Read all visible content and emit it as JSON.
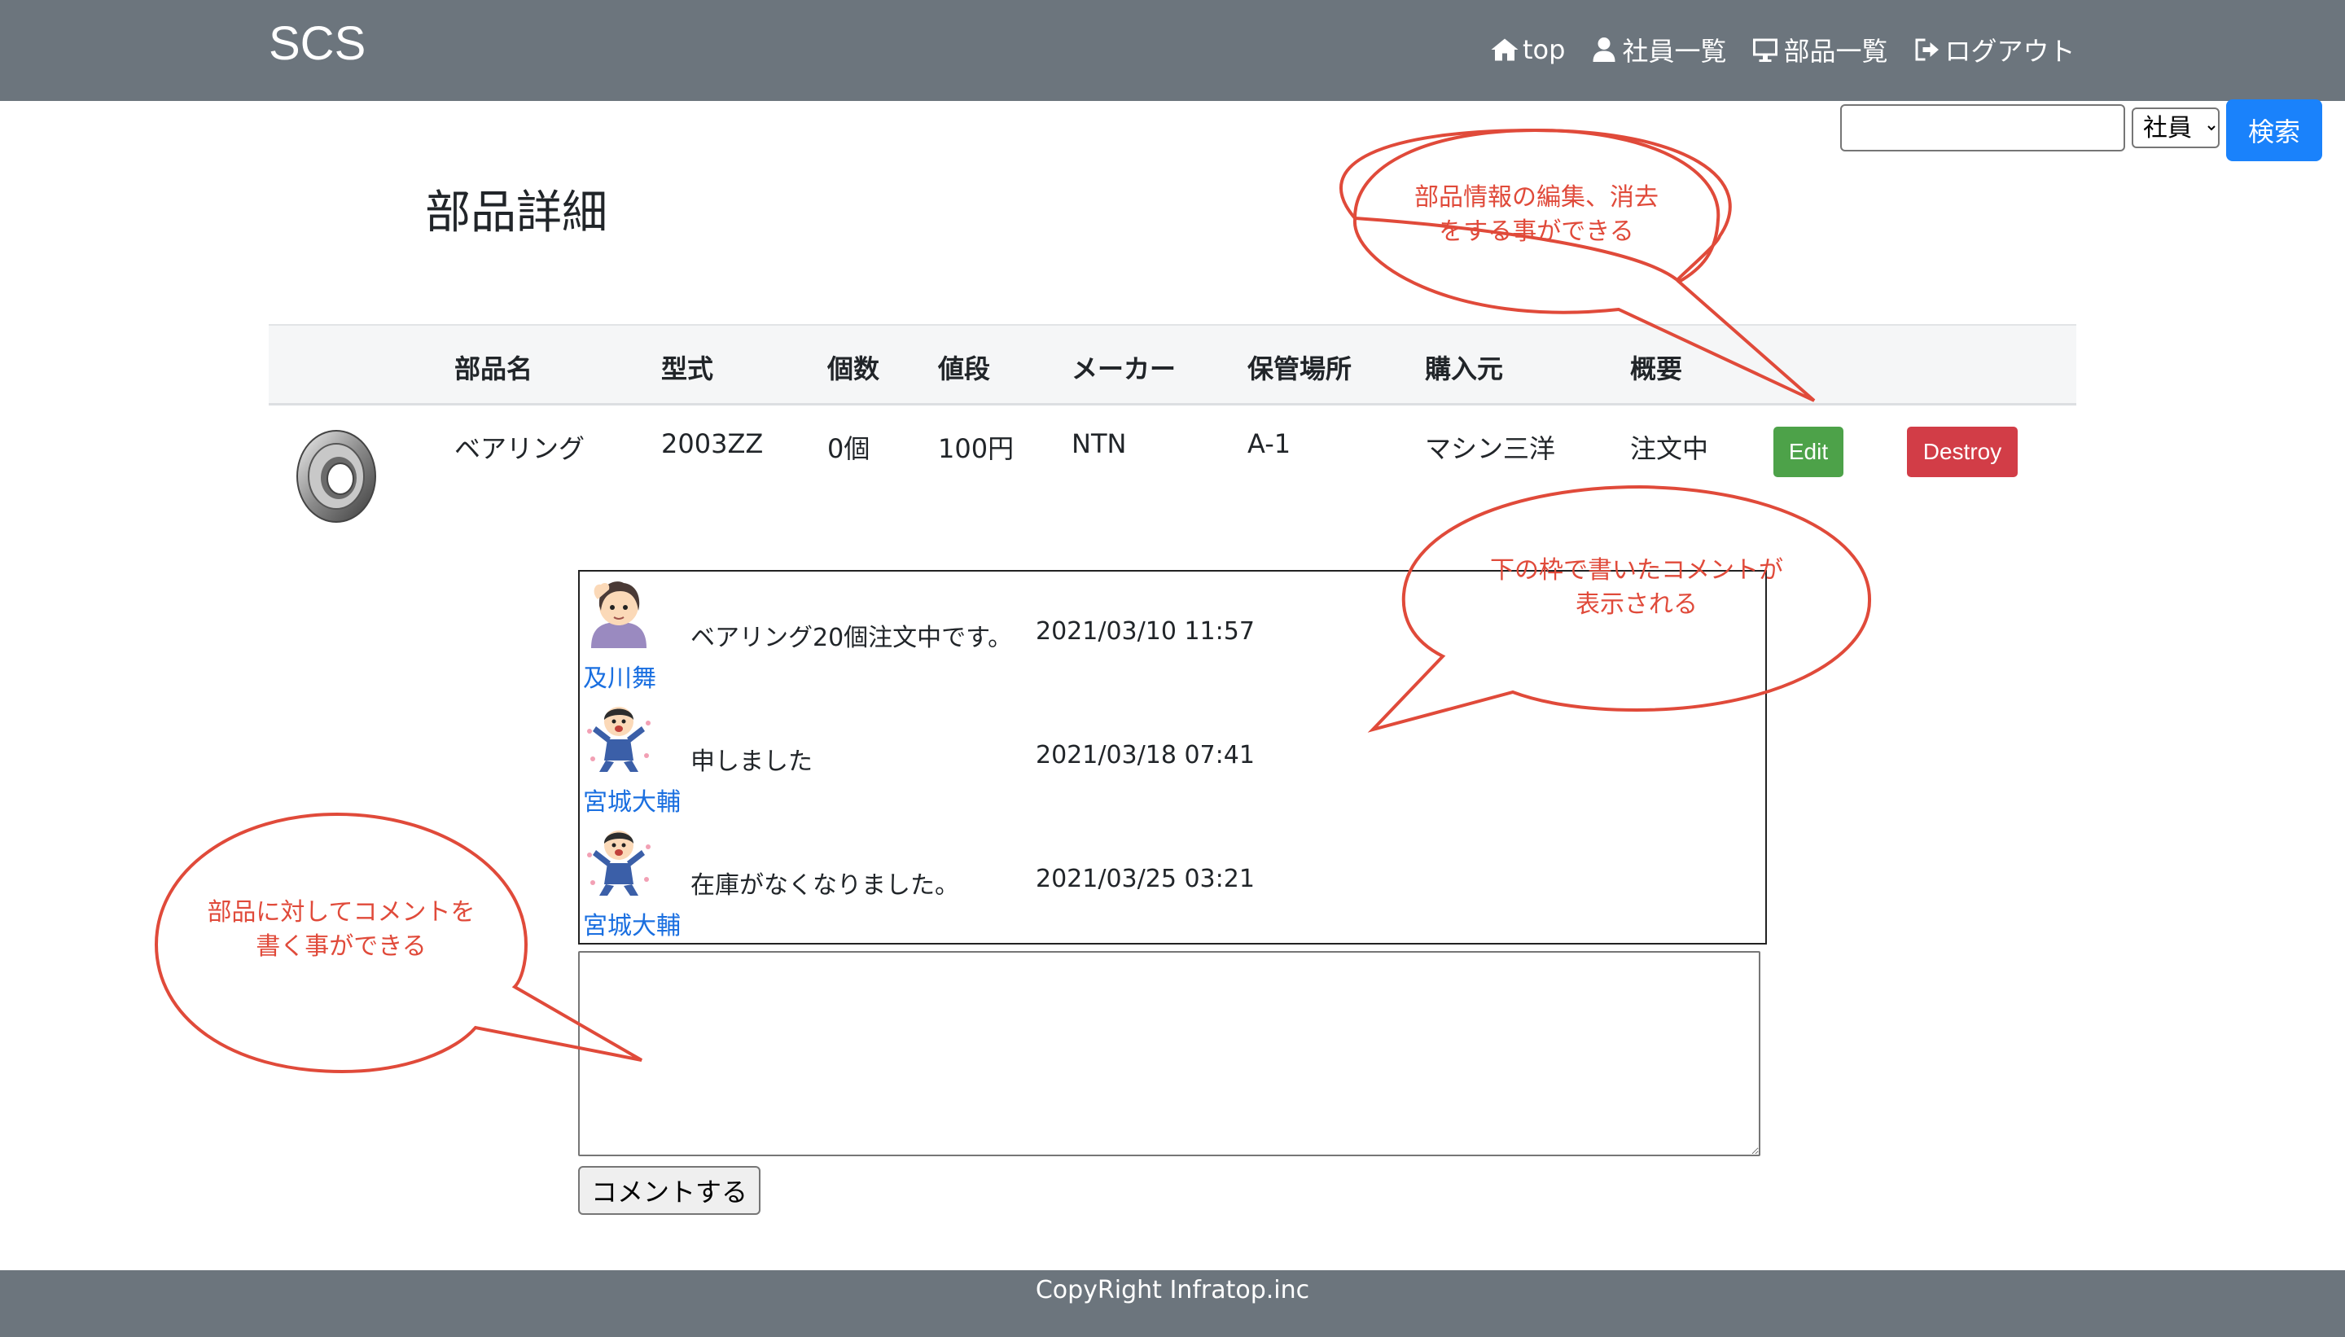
{
  "navbar": {
    "brand": "SCS",
    "links": [
      {
        "icon": "home-icon",
        "label": "top"
      },
      {
        "icon": "user-icon",
        "label": "社員一覧"
      },
      {
        "icon": "monitor-icon",
        "label": "部品一覧"
      },
      {
        "icon": "logout-icon",
        "label": "ログアウト"
      }
    ]
  },
  "search": {
    "value": "",
    "select_value": "社員",
    "button_label": "検索"
  },
  "page": {
    "title": "部品詳細"
  },
  "table": {
    "headers": [
      "部品名",
      "型式",
      "個数",
      "値段",
      "メーカー",
      "保管場所",
      "購入元",
      "概要"
    ],
    "row": {
      "image_icon": "bearing-image",
      "cells": [
        "ベアリング",
        "2003ZZ",
        "0個",
        "100円",
        "NTN",
        "A-1",
        "マシン三洋",
        "注文中"
      ]
    },
    "edit_label": "Edit",
    "destroy_label": "Destroy"
  },
  "comments": [
    {
      "avatar": "woman-avatar-icon",
      "author": "及川舞",
      "text": "ベアリング20個注文中です。",
      "time": "2021/03/10 11:57"
    },
    {
      "avatar": "boy-avatar-icon",
      "author": "宮城大輔",
      "text": "申しました",
      "time": "2021/03/18 07:41"
    },
    {
      "avatar": "boy-avatar-icon",
      "author": "宮城大輔",
      "text": "在庫がなくなりました。",
      "time": "2021/03/25 03:21"
    }
  ],
  "comment_form": {
    "value": "",
    "submit_label": "コメントする"
  },
  "annotations": {
    "edit_note": [
      "部品情報の編集、消去",
      "をする事ができる"
    ],
    "comments_note": [
      "下の枠で書いたコメントが",
      "表示される"
    ],
    "form_note": [
      "部品に対してコメントを",
      "書く事ができる"
    ]
  },
  "footer": {
    "text": "CopyRight Infratop.inc"
  },
  "colors": {
    "navbar": "#6c757d",
    "primary": "#1a82fb",
    "success": "#4da249",
    "danger": "#d23d47",
    "link": "#1a6fe0",
    "annotation": "#e04a3a"
  }
}
